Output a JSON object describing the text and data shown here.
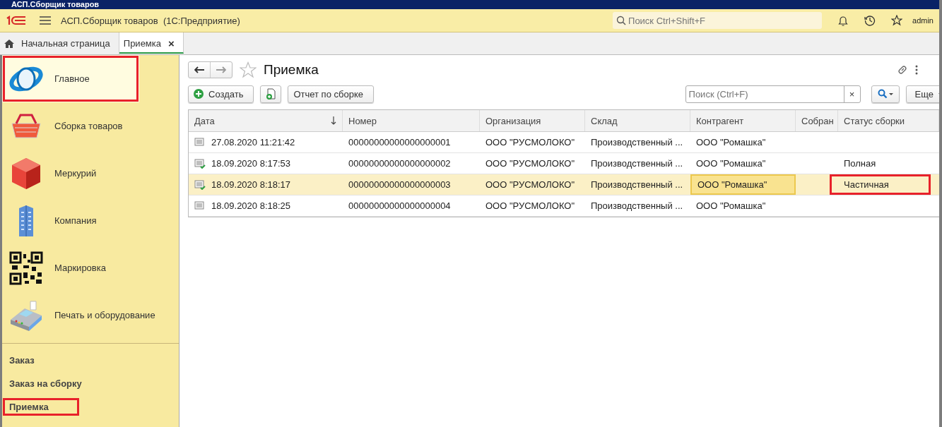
{
  "window": {
    "title": "АСП.Сборщик товаров"
  },
  "topbar": {
    "app_title": "АСП.Сборщик товаров  (1С:Предприятие)",
    "search": {
      "placeholder": "Поиск Ctrl+Shift+F"
    },
    "user": "admin"
  },
  "tabs": [
    {
      "label": "Начальная страница",
      "selected": false,
      "kind": "home"
    },
    {
      "label": "Приемка",
      "selected": true,
      "kind": "page",
      "close": "×"
    }
  ],
  "sidebar": {
    "sections": [
      {
        "label": "Главное",
        "selected": true,
        "highlighted": true,
        "kind": "globe"
      },
      {
        "label": "Сборка товаров",
        "selected": false,
        "highlighted": false,
        "kind": "basket"
      },
      {
        "label": "Меркурий",
        "selected": false,
        "highlighted": false,
        "kind": "cube"
      },
      {
        "label": "Компания",
        "selected": false,
        "highlighted": false,
        "kind": "building"
      },
      {
        "label": "Маркировка",
        "selected": false,
        "highlighted": false,
        "kind": "qr"
      },
      {
        "label": "Печать и оборудование",
        "selected": false,
        "highlighted": false,
        "kind": "terminal"
      }
    ],
    "links": [
      {
        "label": "Заказ",
        "highlighted": false
      },
      {
        "label": "Заказ на сборку",
        "highlighted": false
      },
      {
        "label": "Приемка",
        "highlighted": true
      }
    ]
  },
  "form": {
    "title": "Приемка",
    "create_button": "Создать",
    "report_button": "Отчет по сборке",
    "search": {
      "placeholder": "Поиск (Ctrl+F)"
    },
    "clear": "×",
    "more_button": "Еще",
    "table": {
      "columns": [
        "Дата",
        "Номер",
        "Организация",
        "Склад",
        "Контрагент",
        "Собран",
        "Статус сборки"
      ],
      "rows": [
        {
          "posted": false,
          "selected": false,
          "cells": [
            "27.08.2020 11:21:42",
            "00000000000000000001",
            "ООО \"РУСМОЛОКО\"",
            "Производственный ...",
            "ООО \"Ромашка\"",
            "",
            ""
          ],
          "status_highlighted": false
        },
        {
          "posted": true,
          "selected": false,
          "cells": [
            "18.09.2020 8:17:53",
            "00000000000000000002",
            "ООО \"РУСМОЛОКО\"",
            "Производственный ...",
            "ООО \"Ромашка\"",
            "",
            "Полная"
          ],
          "status_highlighted": false
        },
        {
          "posted": true,
          "selected": true,
          "cells": [
            "18.09.2020 8:18:17",
            "00000000000000000003",
            "ООО \"РУСМОЛОКО\"",
            "Производственный ...",
            "ООО \"Ромашка\"",
            "",
            "Частичная"
          ],
          "status_highlighted": true
        },
        {
          "posted": false,
          "selected": false,
          "cells": [
            "18.09.2020 8:18:25",
            "00000000000000000004",
            "ООО \"РУСМОЛОКО\"",
            "Производственный ...",
            "ООО \"Ромашка\"",
            "",
            ""
          ],
          "status_highlighted": false
        }
      ]
    }
  }
}
